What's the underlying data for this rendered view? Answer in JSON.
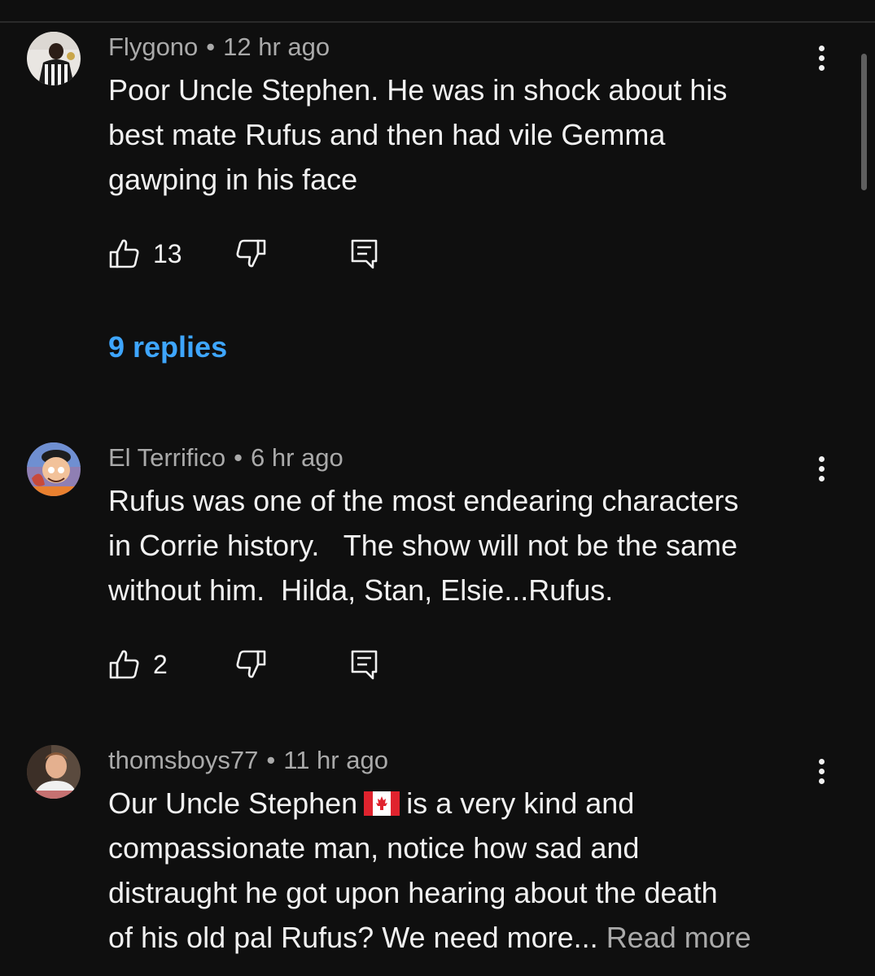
{
  "comments": [
    {
      "author": "Flygono",
      "time": "12 hr ago",
      "text": "Poor Uncle Stephen. He was in shock about his\nbest mate Rufus and then had vile Gemma\ngawping in his face",
      "likes": "13",
      "replies": "9 replies"
    },
    {
      "author": "El Terrifico",
      "time": "6 hr ago",
      "text": "Rufus was one of the most endearing characters\nin Corrie history.   The show will not be the same\nwithout him.  Hilda, Stan, Elsie...Rufus.",
      "likes": "2"
    },
    {
      "author": "thomsboys77",
      "time": "11 hr ago",
      "text_before_flag": "Our Uncle Stephen",
      "flag_icon": "canada-flag-icon",
      "text_after_flag": "is a very kind and\ncompassionate man, notice how sad and\ndistraught he got upon hearing about the death\nof his old pal Rufus? We need more...",
      "read_more": "Read more"
    }
  ],
  "meta_separator": "•",
  "icons": {
    "like": "thumbs-up-icon",
    "dislike": "thumbs-down-icon",
    "reply": "reply-comment-icon",
    "menu": "kebab-menu-icon"
  },
  "colors": {
    "background": "#0f0f0f",
    "text": "#f1f1f1",
    "meta": "#aaaaaa",
    "link": "#3ea6ff"
  }
}
